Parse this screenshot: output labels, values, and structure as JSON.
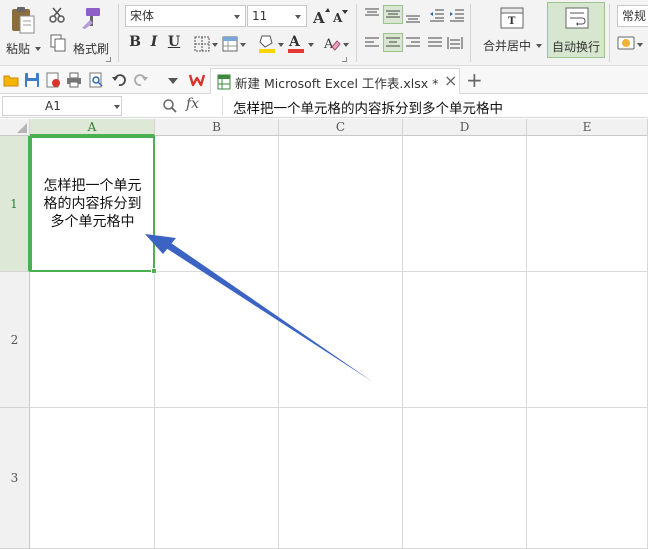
{
  "ribbon": {
    "paste_label": "粘贴",
    "format_painter_label": "格式刷",
    "font_name": "宋体",
    "font_size": "11",
    "bold": "B",
    "italic": "I",
    "underline": "U",
    "merge_center_label": "合并居中",
    "wrap_text_label": "自动换行",
    "number_format_label": "常规"
  },
  "tabs": {
    "document_tab_label": "新建 Microsoft Excel 工作表.xlsx *",
    "close_glyph": "×",
    "new_tab_glyph": "+"
  },
  "formula_bar": {
    "name_box": "A1",
    "fx_label": "fx",
    "content": "怎样把一个单元格的内容拆分到多个单元格中"
  },
  "grid": {
    "columns": [
      "A",
      "B",
      "C",
      "D",
      "E"
    ],
    "rows": [
      "1",
      "2",
      "3"
    ],
    "active_cell": {
      "ref": "A1",
      "lines": [
        "怎样把一个单元",
        "格的内容拆分到",
        "多个单元格中"
      ]
    }
  },
  "colors": {
    "selection": "#4caf50",
    "arrow": "#3a63c4",
    "wps_red": "#d9342b"
  }
}
